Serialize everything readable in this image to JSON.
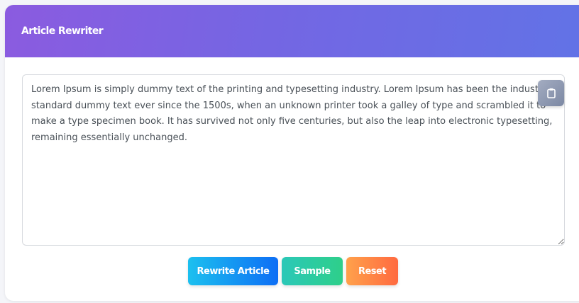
{
  "header": {
    "title": "Article Rewriter"
  },
  "editor": {
    "lines": [
      "Lorem Ipsum is simply dummy text of the printing and typesetting industry. Lorem Ipsum has been the industry's",
      "standard dummy text ever since the 1500s, when an unknown printer took a galley of type and scrambled it to",
      "make a type specimen book. It has survived not only five centuries, but also the leap into electronic typesetting,",
      "remaining essentially unchanged."
    ],
    "copy_icon": "clipboard-icon"
  },
  "actions": {
    "rewrite_label": "Rewrite Article",
    "sample_label": "Sample",
    "reset_label": "Reset"
  },
  "colors": {
    "header_start": "#8b5be0",
    "header_end": "#6173e6",
    "rewrite": "#0d6ef5",
    "sample": "#2ecf8a",
    "reset": "#ff6a40"
  }
}
